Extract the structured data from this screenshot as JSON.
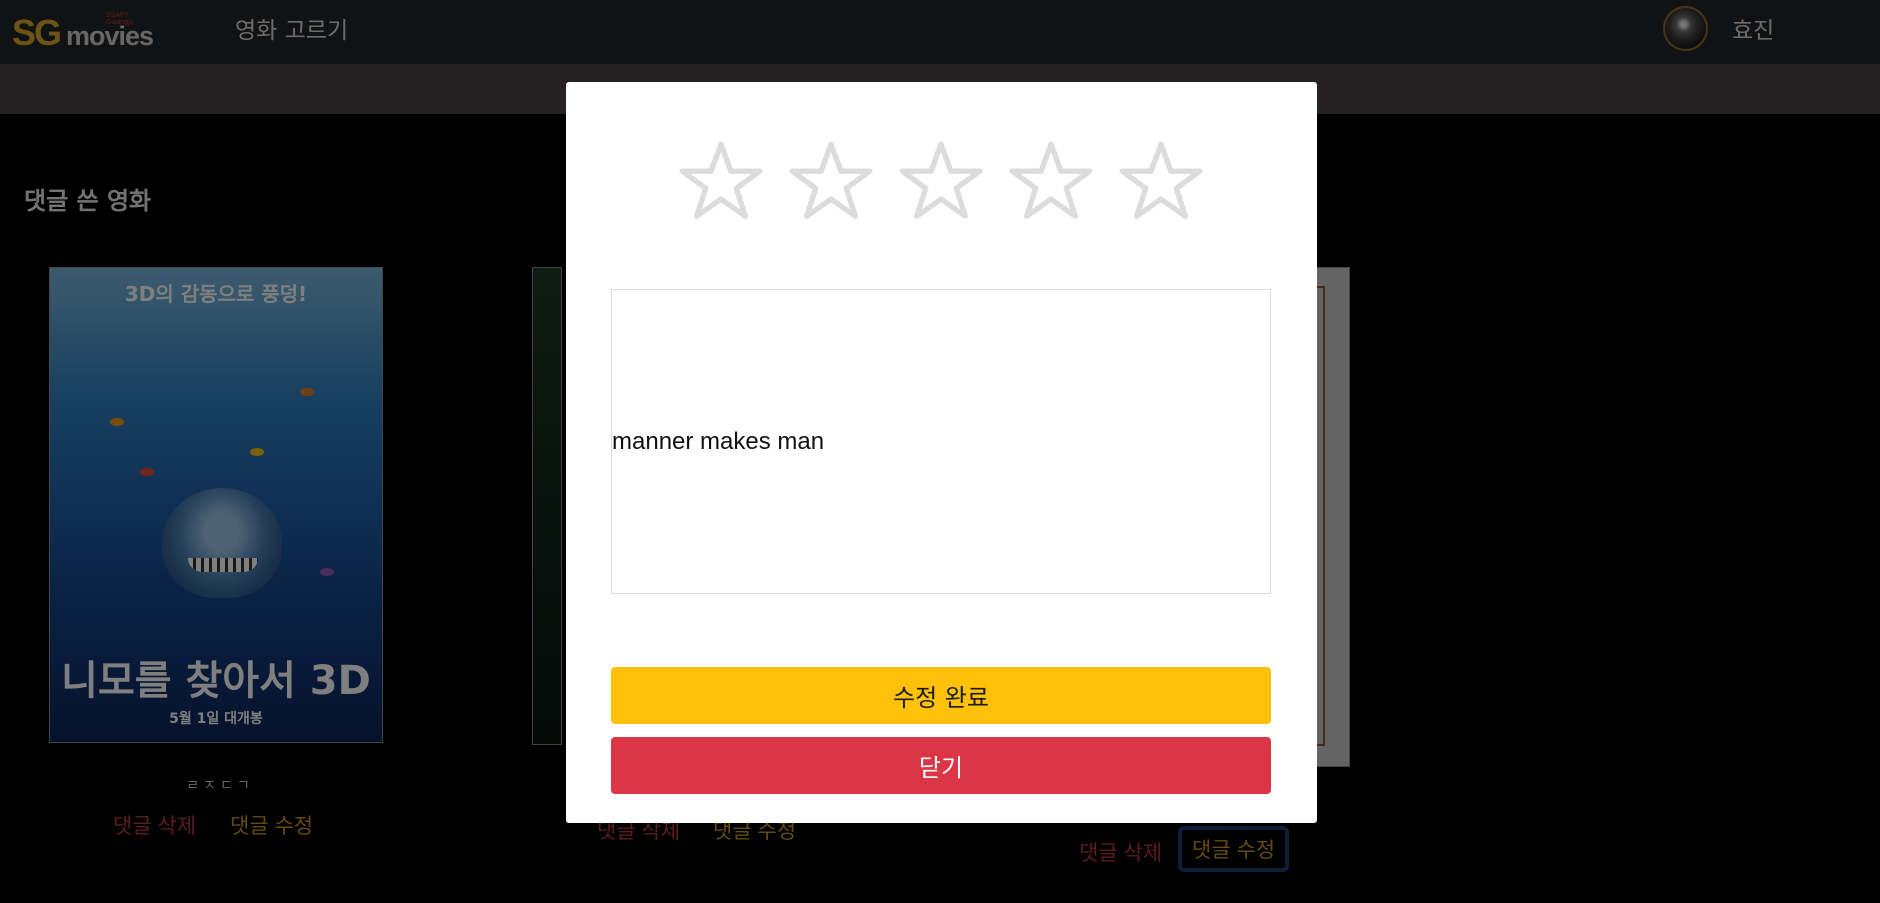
{
  "navbar": {
    "logo_main": "SG",
    "logo_secondary": "movies",
    "logo_sub": "SSAFY Gwangju",
    "menu_link": "영화 고르기",
    "user_name": "효진"
  },
  "section": {
    "title": "댓글 쓴 영화"
  },
  "posters": [
    {
      "top_text": "3D의 감동으로 풍덩!",
      "title": "니모를 찾아서 3D",
      "date": "5월 1일 대개봉",
      "rating_text": "ㄹㅈㄷㄱ",
      "delete_label": "댓글 삭제",
      "edit_label": "댓글 수정"
    },
    {
      "delete_label": "댓글 삭제",
      "edit_label": "댓글 수정"
    },
    {
      "delete_label": "댓글 삭제",
      "edit_label": "댓글 수정"
    }
  ],
  "modal": {
    "star_count": 5,
    "selected_rating": 0,
    "comment": "manner makes man",
    "save_label": "수정 완료",
    "close_label": "닫기"
  },
  "colors": {
    "accent": "#ffc10a",
    "danger": "#dc3545",
    "navbar": "#232427",
    "delete_link": "#b8363d",
    "edit_link": "#c9971b"
  }
}
